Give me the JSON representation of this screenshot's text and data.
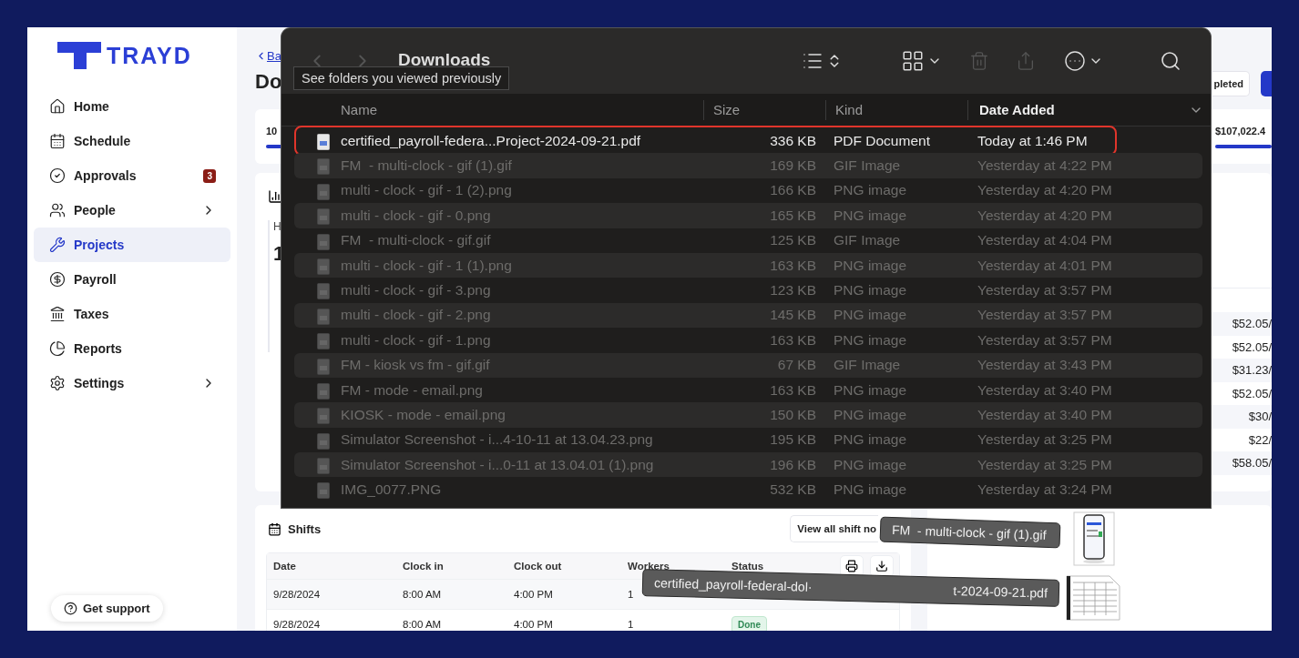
{
  "sidebar": {
    "logo": "TRAYD",
    "items": [
      {
        "label": "Home",
        "selected": false,
        "expandable": false
      },
      {
        "label": "Schedule",
        "selected": false,
        "expandable": false
      },
      {
        "label": "Approvals",
        "selected": false,
        "expandable": false,
        "badge": "3"
      },
      {
        "label": "People",
        "selected": false,
        "expandable": true
      },
      {
        "label": "Projects",
        "selected": true,
        "expandable": false
      },
      {
        "label": "Payroll",
        "selected": false,
        "expandable": false
      },
      {
        "label": "Taxes",
        "selected": false,
        "expandable": false
      },
      {
        "label": "Reports",
        "selected": false,
        "expandable": false
      },
      {
        "label": "Settings",
        "selected": false,
        "expandable": true
      }
    ],
    "support": "Get support"
  },
  "page": {
    "back": "Ba",
    "title": "Do",
    "status_button": "pleted",
    "summary": [
      {
        "label": "10",
        "level": 1
      },
      {
        "label": "$107,022.4",
        "level": 1
      }
    ],
    "metric": {
      "label": "H",
      "value": "1"
    },
    "rates": [
      "$52.05/",
      "$52.05/",
      "$31.23/",
      "$52.05/",
      "$30/",
      "$22/",
      "$58.05/"
    ],
    "shifts": {
      "title": "Shifts",
      "button": "View all shift no",
      "columns": [
        "Date",
        "Clock in",
        "Clock out",
        "Workers",
        "Status"
      ],
      "rows": [
        {
          "date": "9/28/2024",
          "clock_in": "8:00 AM",
          "clock_out": "4:00 PM",
          "workers": "1"
        },
        {
          "date": "9/28/2024",
          "clock_in": "8:00 AM",
          "clock_out": "4:00 PM",
          "workers": "1",
          "status": "Done"
        }
      ]
    }
  },
  "finder": {
    "title": "Downloads",
    "tooltip": "See folders you viewed previously",
    "columns": [
      {
        "label": "Name",
        "selected": false
      },
      {
        "label": "Size",
        "selected": false
      },
      {
        "label": "Kind",
        "selected": false
      },
      {
        "label": "Date Added",
        "selected": true
      }
    ],
    "rows": [
      {
        "name": "certified_payroll-federa...Project-2024-09-21.pdf",
        "size": "336 KB",
        "kind": "PDF Document",
        "date": "Today at 1:46 PM",
        "dimmed": false,
        "outlined": true
      },
      {
        "name": "FM  - multi-clock - gif (1).gif",
        "size": "169 KB",
        "kind": "GIF Image",
        "date": "Yesterday at 4:22 PM",
        "dimmed": true,
        "outlined": false
      },
      {
        "name": "multi - clock - gif - 1 (2).png",
        "size": "166 KB",
        "kind": "PNG image",
        "date": "Yesterday at 4:20 PM",
        "dimmed": true,
        "outlined": false
      },
      {
        "name": "multi - clock - gif - 0.png",
        "size": "165 KB",
        "kind": "PNG image",
        "date": "Yesterday at 4:20 PM",
        "dimmed": true,
        "outlined": false
      },
      {
        "name": "FM  - multi-clock - gif.gif",
        "size": "125 KB",
        "kind": "GIF Image",
        "date": "Yesterday at 4:04 PM",
        "dimmed": true,
        "outlined": false
      },
      {
        "name": "multi - clock - gif - 1 (1).png",
        "size": "163 KB",
        "kind": "PNG image",
        "date": "Yesterday at 4:01 PM",
        "dimmed": true,
        "outlined": false
      },
      {
        "name": "multi - clock - gif - 3.png",
        "size": "123 KB",
        "kind": "PNG image",
        "date": "Yesterday at 3:57 PM",
        "dimmed": true,
        "outlined": false
      },
      {
        "name": "multi - clock - gif - 2.png",
        "size": "145 KB",
        "kind": "PNG image",
        "date": "Yesterday at 3:57 PM",
        "dimmed": true,
        "outlined": false
      },
      {
        "name": "multi - clock - gif - 1.png",
        "size": "163 KB",
        "kind": "PNG image",
        "date": "Yesterday at 3:57 PM",
        "dimmed": true,
        "outlined": false
      },
      {
        "name": "FM - kiosk vs fm - gif.gif",
        "size": "67 KB",
        "kind": "GIF Image",
        "date": "Yesterday at 3:43 PM",
        "dimmed": true,
        "outlined": false
      },
      {
        "name": "FM - mode - email.png",
        "size": "163 KB",
        "kind": "PNG image",
        "date": "Yesterday at 3:40 PM",
        "dimmed": true,
        "outlined": false
      },
      {
        "name": "KIOSK - mode - email.png",
        "size": "150 KB",
        "kind": "PNG image",
        "date": "Yesterday at 3:40 PM",
        "dimmed": true,
        "outlined": false
      },
      {
        "name": "Simulator Screenshot - i...4-10-11 at 13.04.23.png",
        "size": "195 KB",
        "kind": "PNG image",
        "date": "Yesterday at 3:25 PM",
        "dimmed": true,
        "outlined": false
      },
      {
        "name": "Simulator Screenshot - i...0-11 at 13.04.01 (1).png",
        "size": "196 KB",
        "kind": "PNG image",
        "date": "Yesterday at 3:25 PM",
        "dimmed": true,
        "outlined": false
      },
      {
        "name": "IMG_0077.PNG",
        "size": "532 KB",
        "kind": "PNG image",
        "date": "Yesterday at 3:24 PM",
        "dimmed": true,
        "outlined": false
      }
    ]
  },
  "drag": [
    {
      "kind": "phone",
      "labels": [
        "FM  - multi-clock - gif (1).gif"
      ]
    },
    {
      "kind": "document",
      "labels": [
        "certified_payroll-federal-dol·",
        "t-2024-09-21.pdf"
      ]
    }
  ]
}
